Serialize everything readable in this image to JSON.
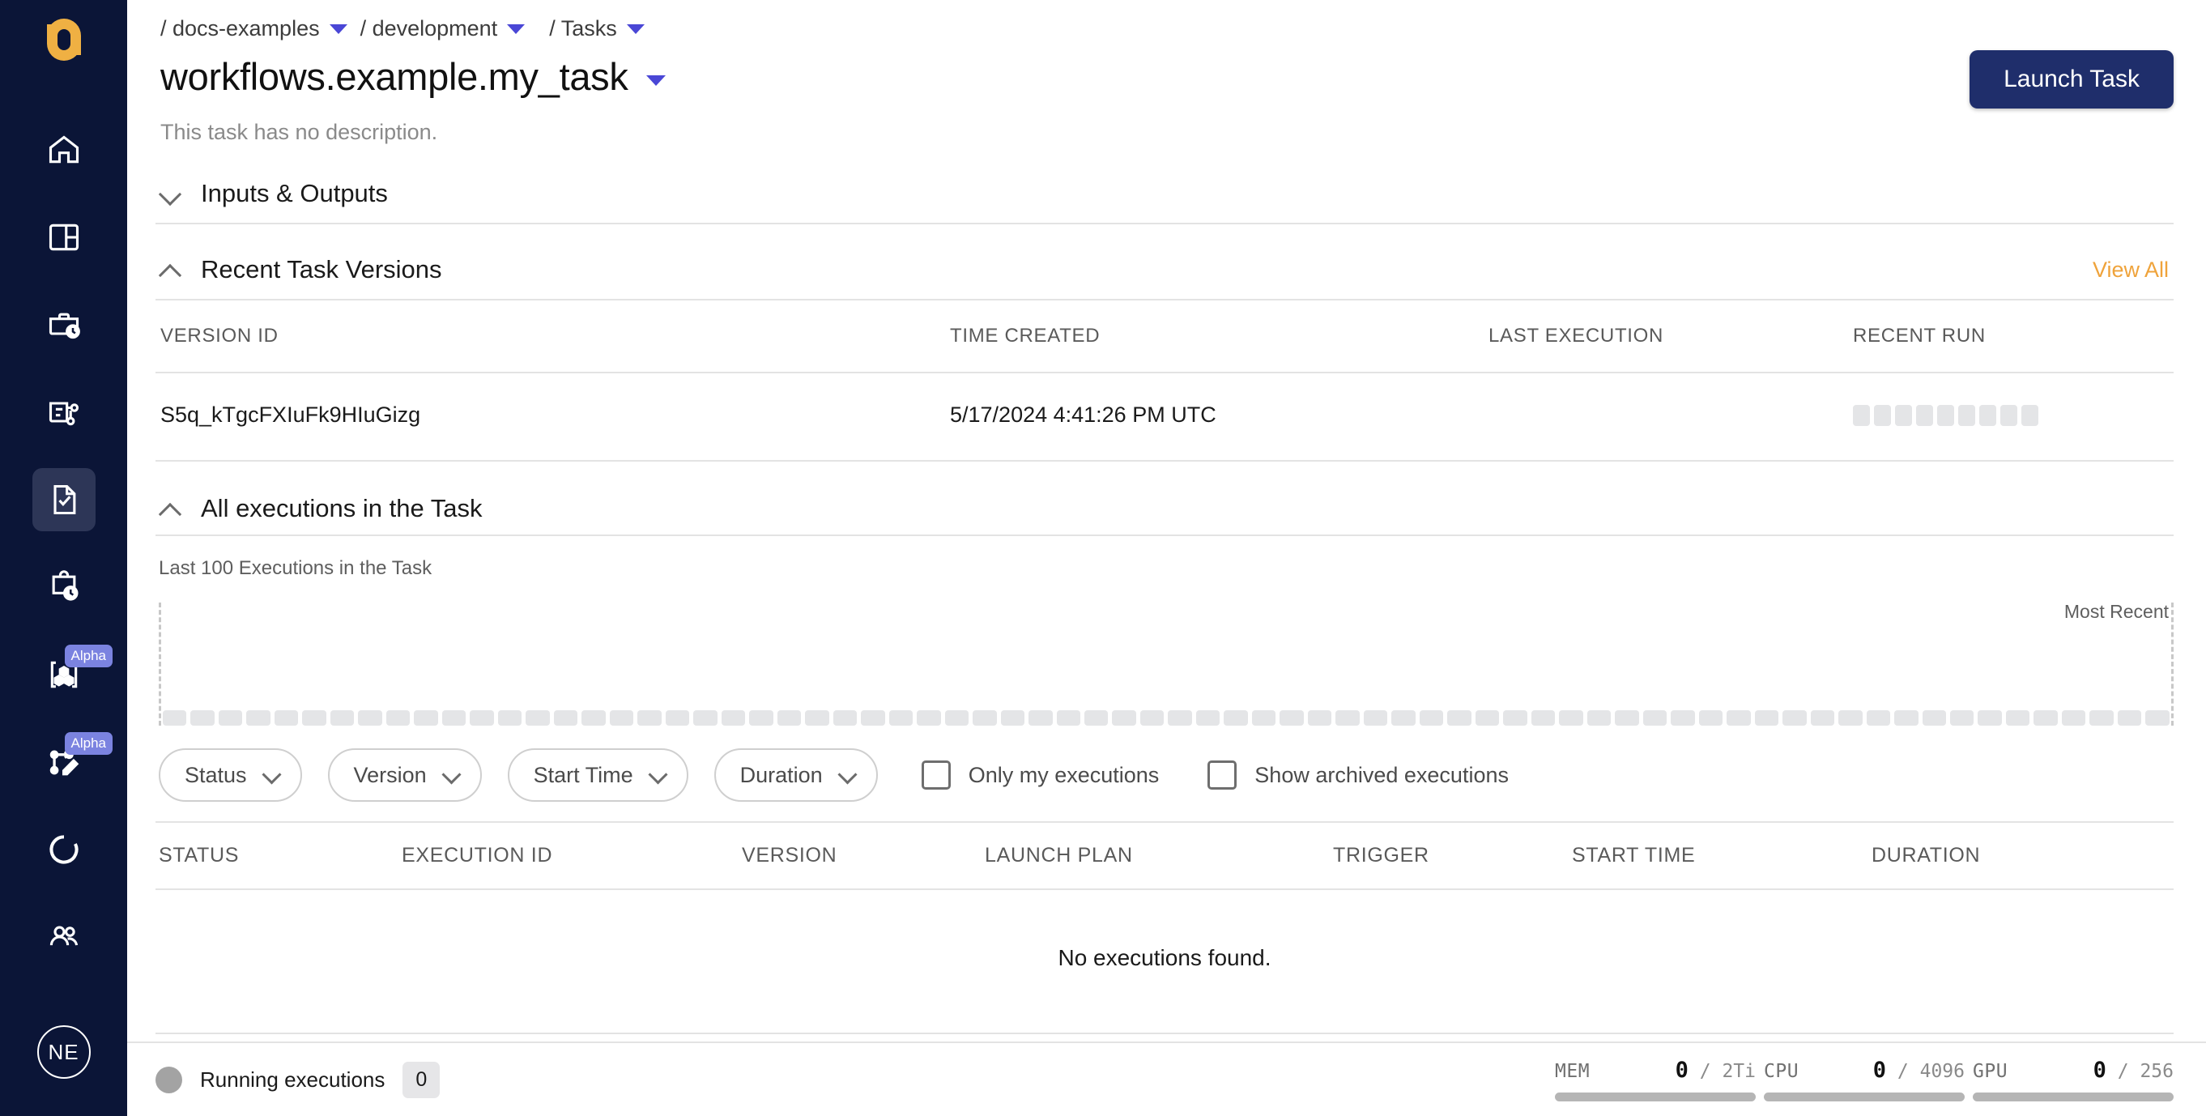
{
  "sidebar": {
    "logo_name": "union-logo",
    "items": [
      {
        "icon": "home-icon",
        "name": "sidebar-item-home",
        "active": false,
        "badge": null
      },
      {
        "icon": "dashboard-icon",
        "name": "sidebar-item-dashboard",
        "active": false,
        "badge": null
      },
      {
        "icon": "briefcase-clock-icon",
        "name": "sidebar-item-projects",
        "active": false,
        "badge": null
      },
      {
        "icon": "workflow-card-icon",
        "name": "sidebar-item-workflows",
        "active": false,
        "badge": null
      },
      {
        "icon": "task-check-icon",
        "name": "sidebar-item-tasks",
        "active": true,
        "badge": null
      },
      {
        "icon": "clipboard-clock-icon",
        "name": "sidebar-item-executions",
        "active": false,
        "badge": null
      },
      {
        "icon": "artifacts-cubes-icon",
        "name": "sidebar-item-artifacts",
        "active": false,
        "badge": "Alpha"
      },
      {
        "icon": "workflow-edit-icon",
        "name": "sidebar-item-builder",
        "active": false,
        "badge": "Alpha"
      },
      {
        "icon": "donut-chart-icon",
        "name": "sidebar-item-usage",
        "active": false,
        "badge": null
      },
      {
        "icon": "users-icon",
        "name": "sidebar-item-team",
        "active": false,
        "badge": null
      }
    ],
    "avatar_initials": "NE"
  },
  "header": {
    "breadcrumb": [
      {
        "label": "/ docs-examples",
        "has_caret": true
      },
      {
        "label": "/ development",
        "has_caret": true
      },
      {
        "label": "/ Tasks",
        "has_caret": true
      }
    ],
    "title": "workflows.example.my_task",
    "description": "This task has no description.",
    "launch_button": "Launch Task"
  },
  "sections": {
    "inputs_outputs": {
      "title": "Inputs & Outputs",
      "expanded": false
    },
    "recent_versions": {
      "title": "Recent Task Versions",
      "expanded": true,
      "view_all": "View All",
      "columns": [
        "VERSION ID",
        "TIME CREATED",
        "LAST EXECUTION",
        "RECENT RUN"
      ],
      "rows": [
        {
          "version_id": "S5q_kTgcFXIuFk9HIuGizg",
          "time_created": "5/17/2024 4:41:26 PM UTC",
          "last_execution": "",
          "recent_run_blocks": 9
        }
      ]
    },
    "all_executions": {
      "title": "All executions in the Task",
      "expanded": true,
      "subtitle": "Last 100 Executions in the Task",
      "most_recent_label": "Most Recent",
      "chart_bar_count": 72,
      "filters": [
        {
          "label": "Status",
          "name": "filter-status"
        },
        {
          "label": "Version",
          "name": "filter-version"
        },
        {
          "label": "Start Time",
          "name": "filter-start-time"
        },
        {
          "label": "Duration",
          "name": "filter-duration"
        }
      ],
      "checkboxes": [
        {
          "label": "Only my executions",
          "name": "checkbox-only-my-executions",
          "checked": false
        },
        {
          "label": "Show archived executions",
          "name": "checkbox-show-archived-executions",
          "checked": false
        }
      ],
      "columns": [
        "STATUS",
        "EXECUTION ID",
        "VERSION",
        "LAUNCH PLAN",
        "TRIGGER",
        "START TIME",
        "DURATION"
      ],
      "empty_message": "No executions found."
    }
  },
  "statusbar": {
    "running_label": "Running executions",
    "running_count": "0",
    "resources": [
      {
        "name": "MEM",
        "used": "0",
        "total": "2Ti",
        "percent": 0
      },
      {
        "name": "CPU",
        "used": "0",
        "total": "4096",
        "percent": 0
      },
      {
        "name": "GPU",
        "used": "0",
        "total": "256",
        "percent": 0
      }
    ]
  },
  "colors": {
    "sidebar_bg": "#0B1537",
    "logo": "#EFB043",
    "accent_orange": "#EFA33B",
    "accent_purple": "#4A47D6",
    "alpha_badge": "#7B83E0",
    "launch_button": "#1F2E6B"
  }
}
